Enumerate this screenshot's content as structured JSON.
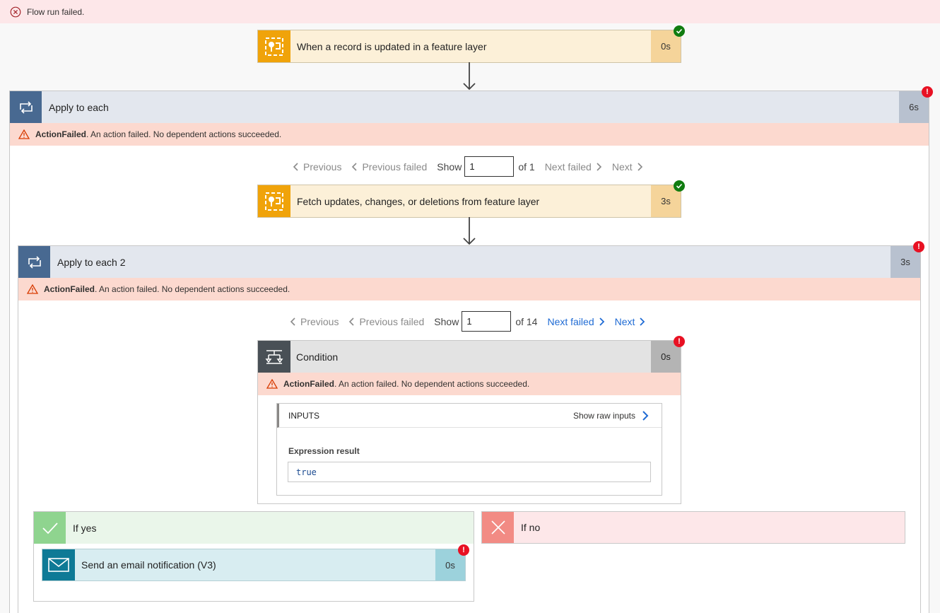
{
  "banner": {
    "text": "Flow run failed."
  },
  "trigger": {
    "title": "When a record is updated in a feature layer",
    "duration": "0s"
  },
  "apply1": {
    "title": "Apply to each",
    "duration": "6s",
    "error_code": "ActionFailed",
    "error_msg": ". An action failed. No dependent actions succeeded.",
    "pager": {
      "previous": "Previous",
      "previous_failed": "Previous failed",
      "show": "Show",
      "value": "1",
      "of": "of 1",
      "next_failed": "Next failed",
      "next": "Next"
    }
  },
  "fetch": {
    "title": "Fetch updates, changes, or deletions from feature layer",
    "duration": "3s"
  },
  "apply2": {
    "title": "Apply to each 2",
    "duration": "3s",
    "error_code": "ActionFailed",
    "error_msg": ". An action failed. No dependent actions succeeded.",
    "pager": {
      "previous": "Previous",
      "previous_failed": "Previous failed",
      "show": "Show",
      "value": "1",
      "of": "of 14",
      "next_failed": "Next failed",
      "next": "Next"
    }
  },
  "condition": {
    "title": "Condition",
    "duration": "0s",
    "error_code": "ActionFailed",
    "error_msg": ". An action failed. No dependent actions succeeded.",
    "inputs_label": "INPUTS",
    "show_raw": "Show raw inputs",
    "expr_label": "Expression result",
    "expr_value": "true"
  },
  "if_yes": {
    "title": "If yes",
    "color": "#8fd48f"
  },
  "if_no": {
    "title": "If no",
    "color": "#f28b84"
  },
  "email": {
    "title": "Send an email notification (V3)",
    "duration": "0s"
  },
  "colors": {
    "arcgis": "#f0a30a",
    "loop": "#486991",
    "error_bg": "#fcd9cf",
    "link": "#1f6bd4"
  }
}
